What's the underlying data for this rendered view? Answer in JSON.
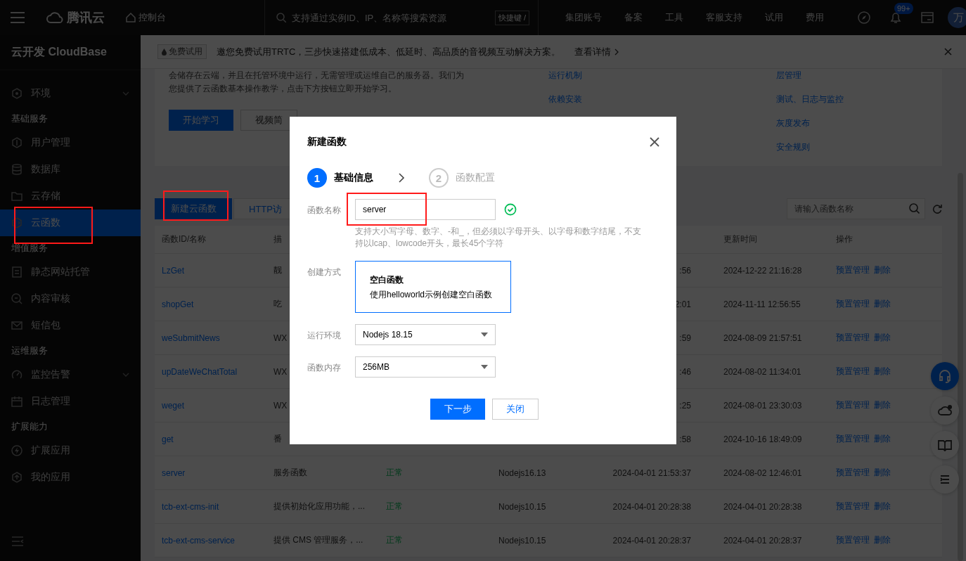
{
  "topbar": {
    "logo": "腾讯云",
    "console": "控制台",
    "search": {
      "placeholder": "支持通过实例ID、IP、名称等搜索资源",
      "shortcut": "快捷键 /"
    },
    "links": [
      "集团账号",
      "备案",
      "工具",
      "客服支持",
      "试用",
      "费用"
    ],
    "notification_count": "99+",
    "avatar": "万"
  },
  "sidebar": {
    "title": "云开发 CloudBase",
    "sections": [
      {
        "items": [
          {
            "label": "环境",
            "kind": "menu",
            "selected": false,
            "highlighted": false
          }
        ]
      },
      {
        "heading": "基础服务",
        "items": [
          {
            "label": "用户管理",
            "kind": "link",
            "selected": false,
            "highlighted": false
          },
          {
            "label": "数据库",
            "kind": "link",
            "selected": false,
            "highlighted": false
          },
          {
            "label": "云存储",
            "kind": "link",
            "selected": false,
            "highlighted": false
          },
          {
            "label": "云函数",
            "kind": "link",
            "selected": true,
            "highlighted": true
          }
        ]
      },
      {
        "heading": "增值服务",
        "items": [
          {
            "label": "静态网站托管",
            "kind": "link",
            "selected": false,
            "highlighted": false
          },
          {
            "label": "内容审核",
            "kind": "link",
            "selected": false,
            "highlighted": false
          },
          {
            "label": "短信包",
            "kind": "link",
            "selected": false,
            "highlighted": false
          }
        ]
      },
      {
        "heading": "运维服务",
        "items": [
          {
            "label": "监控告警",
            "kind": "menu",
            "selected": false,
            "highlighted": false
          },
          {
            "label": "日志管理",
            "kind": "link",
            "selected": false,
            "highlighted": false
          }
        ]
      },
      {
        "heading": "扩展能力",
        "items": [
          {
            "label": "扩展应用",
            "kind": "link",
            "selected": false,
            "highlighted": false
          },
          {
            "label": "我的应用",
            "kind": "link",
            "selected": false,
            "highlighted": false
          }
        ]
      }
    ]
  },
  "banner": {
    "tag": "免费试用",
    "message": "邀您免费试用TRTC，三步快速搭建低成本、低延时、高品质的音视频互动解决方案。",
    "link": "查看详情"
  },
  "intro": {
    "lines": [
      "会储存在云端，并且在托管环境中运行，无需管理或运维自己的服务器。我们为",
      "您提供了云函数基本操作教学，点击下方按钮立即开始学习。"
    ],
    "buttons": [
      {
        "label": "开始学习",
        "kind": "primary"
      },
      {
        "label": "视频简",
        "kind": "secondary"
      }
    ],
    "link_columns": [
      [
        "运行机制",
        "依赖安装"
      ],
      [
        "层管理",
        "测试、日志与监控",
        "灰度发布",
        "安全规则"
      ]
    ]
  },
  "toolbar": {
    "create_button": {
      "label": "新建云函数",
      "highlighted": true
    },
    "tab": "HTTP访",
    "search": {
      "placeholder": "请输入函数名称"
    }
  },
  "table": {
    "columns": {
      "name": "函数ID/名称",
      "description": "描",
      "updated": "更新时间",
      "actions": "操作"
    },
    "rows": [
      {
        "name": "LzGet",
        "description": "靓",
        "created": ":56",
        "updated": "2024-12-22 21:16:28",
        "actions": [
          "预置管理",
          "删除"
        ]
      },
      {
        "name": "shopGet",
        "description": "吃",
        "created": "2:01",
        "updated": "2024-11-11 12:56:55",
        "actions": [
          "预置管理",
          "删除"
        ]
      },
      {
        "name": "weSubmitNews",
        "description": "WX",
        "created": ":59",
        "updated": "2024-08-09 21:57:51",
        "actions": [
          "预置管理",
          "删除"
        ]
      },
      {
        "name": "upDateWeChatTotal",
        "description": "WX",
        "created": ":46",
        "updated": "2024-08-02 11:34:01",
        "actions": [
          "预置管理",
          "删除"
        ]
      },
      {
        "name": "weget",
        "description": "WX",
        "created": ":25",
        "updated": "2024-08-01 23:30:03",
        "actions": [
          "预置管理",
          "删除"
        ]
      },
      {
        "name": "get",
        "description": "番",
        "created": ":58",
        "updated": "2024-10-16 18:49:09",
        "actions": [
          "预置管理",
          "删除"
        ]
      },
      {
        "name": "server",
        "description": "服务函数",
        "status": "正常",
        "runtime": "Nodejs16.13",
        "created": "2024-04-01 21:53:37",
        "updated": "2024-08-02 12:46:01",
        "actions": [
          "预置管理",
          "删除"
        ]
      },
      {
        "name": "tcb-ext-cms-init",
        "description": "提供初始化应用功能，...",
        "status": "正常",
        "runtime": "Nodejs10.15",
        "created": "2024-04-01 20:28:38",
        "updated": "2024-04-01 20:28:38",
        "actions": [
          "预置管理",
          "删除"
        ]
      },
      {
        "name": "tcb-ext-cms-service",
        "description": "提供 CMS 管理服务，...",
        "status": "正常",
        "runtime": "Nodejs10.15",
        "created": "2024-04-01 20:28:37",
        "updated": "2024-04-01 20:28:37",
        "actions": [
          "预置管理",
          "删除"
        ]
      }
    ]
  },
  "dialog": {
    "title": "新建函数",
    "steps": [
      {
        "number": "1",
        "label": "基础信息",
        "selected": true
      },
      {
        "number": "2",
        "label": "函数配置",
        "selected": false
      }
    ],
    "fields": [
      {
        "kind": "text",
        "label": "函数名称",
        "value": "server",
        "valid": true,
        "highlighted": true,
        "hint": "支持大小写字母、数字、-和_，但必须以字母开头、以字母和数字结尾，不支持以lcap、lowcode开头，最长45个字符"
      },
      {
        "kind": "choice",
        "label": "创建方式",
        "options": [
          {
            "title": "空白函数",
            "description": "使用helloworld示例创建空白函数",
            "selected": true
          }
        ]
      },
      {
        "kind": "select",
        "label": "运行环境",
        "value": "Nodejs 18.15"
      },
      {
        "kind": "select",
        "label": "函数内存",
        "value": "256MB"
      }
    ],
    "buttons": [
      {
        "label": "下一步",
        "kind": "primary"
      },
      {
        "label": "关闭",
        "kind": "secondary"
      }
    ]
  }
}
